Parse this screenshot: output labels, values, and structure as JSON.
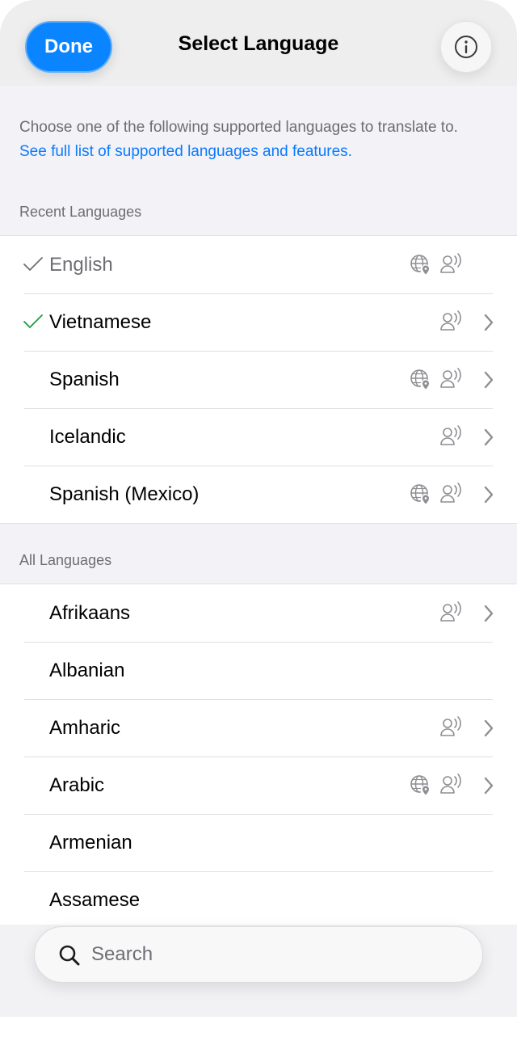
{
  "header": {
    "done_label": "Done",
    "title": "Select Language"
  },
  "intro": {
    "description": "Choose one of the following supported languages to translate to.",
    "link": "See full list of supported languages and features."
  },
  "recent": {
    "header": "Recent Languages",
    "items": [
      {
        "label": "English",
        "checked": true,
        "check_color": "#6e6e73",
        "dim": true,
        "globe": true,
        "speak": true,
        "chevron": false
      },
      {
        "label": "Vietnamese",
        "checked": true,
        "check_color": "#1a9e3a",
        "dim": false,
        "globe": false,
        "speak": true,
        "chevron": true
      },
      {
        "label": "Spanish",
        "checked": false,
        "dim": false,
        "globe": true,
        "speak": true,
        "chevron": true
      },
      {
        "label": "Icelandic",
        "checked": false,
        "dim": false,
        "globe": false,
        "speak": true,
        "chevron": true
      },
      {
        "label": "Spanish (Mexico)",
        "checked": false,
        "dim": false,
        "globe": true,
        "speak": true,
        "chevron": true
      }
    ]
  },
  "all": {
    "header": "All Languages",
    "items": [
      {
        "label": "Afrikaans",
        "globe": false,
        "speak": true,
        "chevron": true
      },
      {
        "label": "Albanian",
        "globe": false,
        "speak": false,
        "chevron": false
      },
      {
        "label": "Amharic",
        "globe": false,
        "speak": true,
        "chevron": true
      },
      {
        "label": "Arabic",
        "globe": true,
        "speak": true,
        "chevron": true
      },
      {
        "label": "Armenian",
        "globe": false,
        "speak": false,
        "chevron": false
      },
      {
        "label": "Assamese",
        "globe": false,
        "speak": false,
        "chevron": false
      }
    ]
  },
  "search": {
    "placeholder": "Search"
  },
  "colors": {
    "accent": "#0a84ff",
    "link": "#0a7aff",
    "secondary_text": "#6d6d72",
    "icon_gray": "#8e8e93"
  }
}
